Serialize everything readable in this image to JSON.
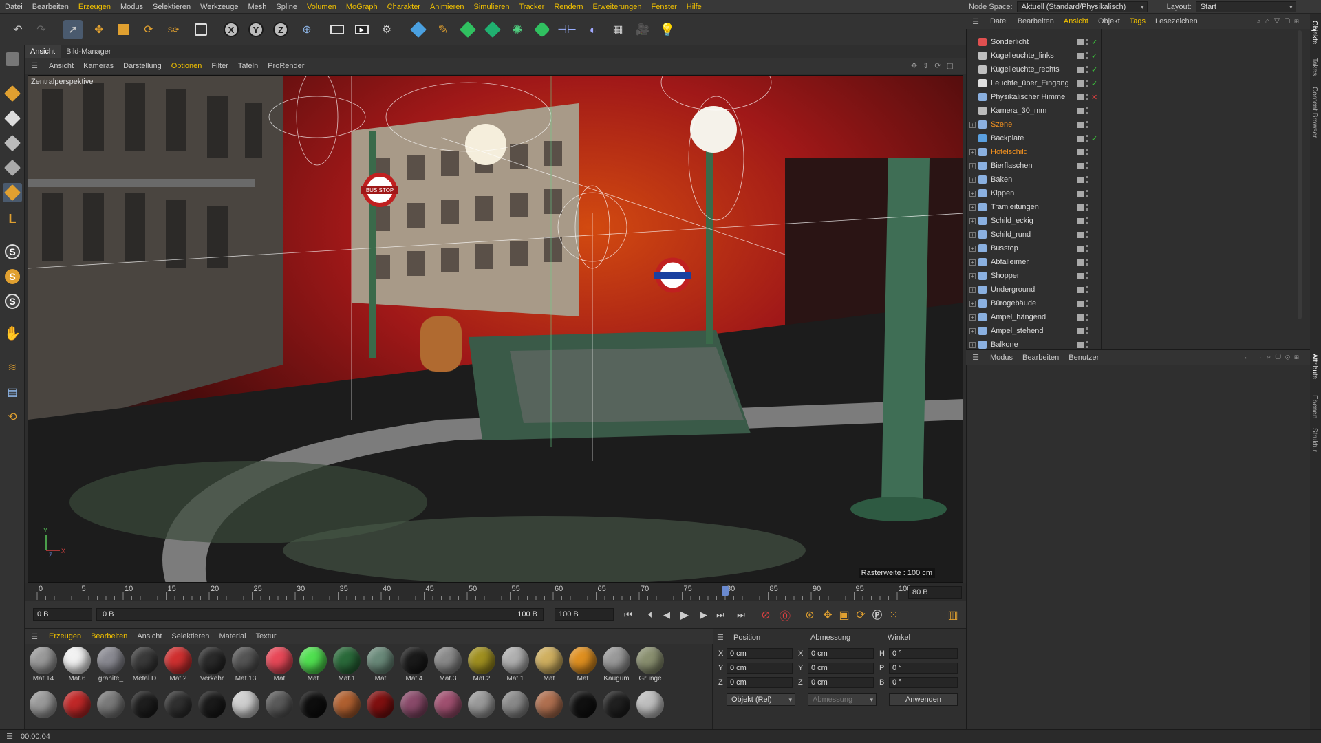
{
  "menubar": {
    "items": [
      "Datei",
      "Bearbeiten",
      "Erzeugen",
      "Modus",
      "Selektieren",
      "Werkzeuge",
      "Mesh",
      "Spline",
      "Volumen",
      "MoGraph",
      "Charakter",
      "Animieren",
      "Simulieren",
      "Tracker",
      "Rendern",
      "Erweiterungen",
      "Fenster",
      "Hilfe"
    ],
    "nodespace_label": "Node Space:",
    "nodespace_value": "Aktuell (Standard/Physikalisch)",
    "layout_label": "Layout:",
    "layout_value": "Start"
  },
  "viewport": {
    "tabs": [
      "Ansicht",
      "Bild-Manager"
    ],
    "menu": [
      "Ansicht",
      "Kameras",
      "Darstellung",
      "Optionen",
      "Filter",
      "Tafeln",
      "ProRender"
    ],
    "camera_label": "Zentralperspektive",
    "grid_label": "Rasterweite : 100 cm",
    "sign_label": "BUS STOP"
  },
  "timeline": {
    "ticks": [
      "0",
      "5",
      "10",
      "15",
      "20",
      "25",
      "30",
      "35",
      "40",
      "45",
      "50",
      "55",
      "60",
      "65",
      "70",
      "75",
      "80",
      "85",
      "90",
      "95",
      "100"
    ],
    "current_frame_field": "80 B",
    "current_frame": 80,
    "start_field": "0 B",
    "range_start": "0 B",
    "range_end": "100 B",
    "end_field": "100 B"
  },
  "materials": {
    "menu": [
      "Erzeugen",
      "Bearbeiten",
      "Ansicht",
      "Selektieren",
      "Material",
      "Textur"
    ],
    "row1": [
      {
        "name": "Mat.14",
        "color": "#9a9a9a"
      },
      {
        "name": "Mat.6",
        "color": "#f2f2f2"
      },
      {
        "name": "granite_",
        "color": "#8a8a92"
      },
      {
        "name": "Metal D",
        "color": "#3a3a3a"
      },
      {
        "name": "Mat.2",
        "color": "#d03030"
      },
      {
        "name": "Verkehr",
        "color": "#2a2a2a"
      },
      {
        "name": "Mat.13",
        "color": "#555555"
      },
      {
        "name": "Mat",
        "color": "#e84858"
      },
      {
        "name": "Mat",
        "color": "#50e050"
      },
      {
        "name": "Mat.1",
        "color": "#2a6a3a"
      },
      {
        "name": "Mat",
        "color": "#6a8a7a"
      },
      {
        "name": "Mat.4",
        "color": "#1a1a1a"
      },
      {
        "name": "Mat.3",
        "color": "#8a8a8a"
      },
      {
        "name": "Mat.2",
        "color": "#a09020"
      },
      {
        "name": "Mat.1",
        "color": "#b0b0b0"
      },
      {
        "name": "Mat",
        "color": "#d0b060"
      },
      {
        "name": "Mat",
        "color": "#e09020"
      },
      {
        "name": "Kaugum",
        "color": "#9a9a9a"
      },
      {
        "name": "Grunge",
        "color": "#8a9070"
      }
    ],
    "row2": [
      {
        "color": "#9a9a9a"
      },
      {
        "color": "#c02828"
      },
      {
        "color": "#7a7a7a"
      },
      {
        "color": "#1e1e1e"
      },
      {
        "color": "#303030"
      },
      {
        "color": "#1a1a1a"
      },
      {
        "color": "#cfcfcf"
      },
      {
        "color": "#5a5a5a"
      },
      {
        "color": "#0e0e0e"
      },
      {
        "color": "#b06030"
      },
      {
        "color": "#801010"
      },
      {
        "color": "#8a4a6a"
      },
      {
        "color": "#a05070"
      },
      {
        "color": "#9a9a9a"
      },
      {
        "color": "#8a8a8a"
      },
      {
        "color": "#b07050"
      },
      {
        "color": "#101010"
      },
      {
        "color": "#202020"
      },
      {
        "color": "#bfbfbf"
      }
    ]
  },
  "coords": {
    "headers": [
      "Position",
      "Abmessung",
      "Winkel"
    ],
    "rows": [
      {
        "axis": "X",
        "pos": "0 cm",
        "axis2": "X",
        "size": "0 cm",
        "axis3": "H",
        "angle": "0 °"
      },
      {
        "axis": "Y",
        "pos": "0 cm",
        "axis2": "Y",
        "size": "0 cm",
        "axis3": "P",
        "angle": "0 °"
      },
      {
        "axis": "Z",
        "pos": "0 cm",
        "axis2": "Z",
        "size": "0 cm",
        "axis3": "B",
        "angle": "0 °"
      }
    ],
    "mode_value": "Objekt (Rel)",
    "size_mode_value": "Abmessung",
    "apply_label": "Anwenden"
  },
  "objects": {
    "menu": [
      "Datei",
      "Bearbeiten",
      "Ansicht",
      "Objekt",
      "Tags",
      "Lesezeichen"
    ],
    "items": [
      {
        "name": "Sonderlicht",
        "icon": "light-icon",
        "icon_color": "#e05050",
        "expand": false,
        "state": "check"
      },
      {
        "name": "Kugelleuchte_links",
        "icon": "light-icon",
        "icon_color": "#c0c0c0",
        "expand": false,
        "state": "check"
      },
      {
        "name": "Kugelleuchte_rechts",
        "icon": "light-icon",
        "icon_color": "#c0c0c0",
        "expand": false,
        "state": "check"
      },
      {
        "name": "Leuchte_über_Eingang",
        "icon": "area-light-icon",
        "icon_color": "#e0e0e0",
        "expand": false,
        "state": "check"
      },
      {
        "name": "Physikalischer Himmel",
        "icon": "sky-icon",
        "icon_color": "#8ab0e0",
        "expand": false,
        "state": "x"
      },
      {
        "name": "Kamera_30_mm",
        "icon": "camera-icon",
        "icon_color": "#bbbbbb",
        "expand": false,
        "state": "none"
      },
      {
        "name": "Szene",
        "icon": "null-icon",
        "icon_color": "#8ab0e0",
        "expand": true,
        "state": "none",
        "orange": true
      },
      {
        "name": "Backplate",
        "icon": "plane-icon",
        "icon_color": "#5aa0e0",
        "expand": false,
        "state": "check"
      },
      {
        "name": "Hotelschild",
        "icon": "object-icon",
        "icon_color": "#8ab0e0",
        "expand": true,
        "state": "none",
        "orange": true
      },
      {
        "name": "Bierflaschen",
        "icon": "object-icon",
        "icon_color": "#8ab0e0",
        "expand": true,
        "state": "none"
      },
      {
        "name": "Baken",
        "icon": "object-icon",
        "icon_color": "#8ab0e0",
        "expand": true,
        "state": "none"
      },
      {
        "name": "Kippen",
        "icon": "object-icon",
        "icon_color": "#8ab0e0",
        "expand": true,
        "state": "none"
      },
      {
        "name": "Tramleitungen",
        "icon": "object-icon",
        "icon_color": "#8ab0e0",
        "expand": true,
        "state": "none"
      },
      {
        "name": "Schild_eckig",
        "icon": "object-icon",
        "icon_color": "#8ab0e0",
        "expand": true,
        "state": "none"
      },
      {
        "name": "Schild_rund",
        "icon": "object-icon",
        "icon_color": "#8ab0e0",
        "expand": true,
        "state": "none"
      },
      {
        "name": "Busstop",
        "icon": "object-icon",
        "icon_color": "#8ab0e0",
        "expand": true,
        "state": "none"
      },
      {
        "name": "Abfalleimer",
        "icon": "object-icon",
        "icon_color": "#8ab0e0",
        "expand": true,
        "state": "none"
      },
      {
        "name": "Shopper",
        "icon": "object-icon",
        "icon_color": "#8ab0e0",
        "expand": true,
        "state": "none"
      },
      {
        "name": "Underground",
        "icon": "object-icon",
        "icon_color": "#8ab0e0",
        "expand": true,
        "state": "none"
      },
      {
        "name": "Bürogebäude",
        "icon": "object-icon",
        "icon_color": "#8ab0e0",
        "expand": true,
        "state": "none"
      },
      {
        "name": "Ampel_hängend",
        "icon": "object-icon",
        "icon_color": "#8ab0e0",
        "expand": true,
        "state": "none"
      },
      {
        "name": "Ampel_stehend",
        "icon": "object-icon",
        "icon_color": "#8ab0e0",
        "expand": true,
        "state": "none"
      },
      {
        "name": "Balkone",
        "icon": "object-icon",
        "icon_color": "#8ab0e0",
        "expand": true,
        "state": "none"
      }
    ]
  },
  "attributes": {
    "menu": [
      "Modus",
      "Bearbeiten",
      "Benutzer"
    ]
  },
  "vtabs": [
    "Objekte",
    "Takes",
    "Content Browser",
    "Attribute",
    "Ebenen",
    "Struktur"
  ],
  "status": {
    "time": "00:00:04"
  },
  "colors": {
    "accent": "#f0c000",
    "orange": "#f09020",
    "check": "#3cd23c",
    "panel": "#2f2f2f"
  }
}
